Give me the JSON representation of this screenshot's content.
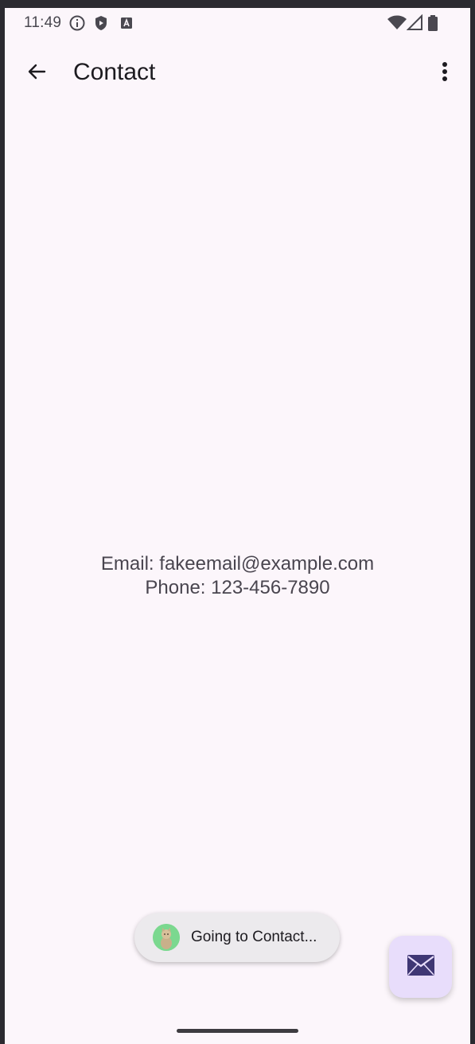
{
  "status_bar": {
    "time": "11:49",
    "left_icons": [
      "info-icon",
      "shield-play-icon",
      "keyboard-a-icon"
    ],
    "right_icons": [
      "wifi-icon",
      "signal-icon",
      "battery-icon"
    ]
  },
  "app_bar": {
    "title": "Contact",
    "back_icon": "arrow-back-icon",
    "menu_icon": "more-vert-icon"
  },
  "content": {
    "email_line": "Email: fakeemail@example.com",
    "phone_line": "Phone: 123-456-7890"
  },
  "toast": {
    "text": "Going to Contact...",
    "avatar_icon": "cat-avatar-icon"
  },
  "fab": {
    "icon": "mail-icon",
    "color": "#e8ddfb",
    "icon_color": "#3f3774"
  },
  "colors": {
    "background": "#fcf6fb",
    "text_primary": "#1d1b20",
    "text_secondary": "#49454f"
  }
}
